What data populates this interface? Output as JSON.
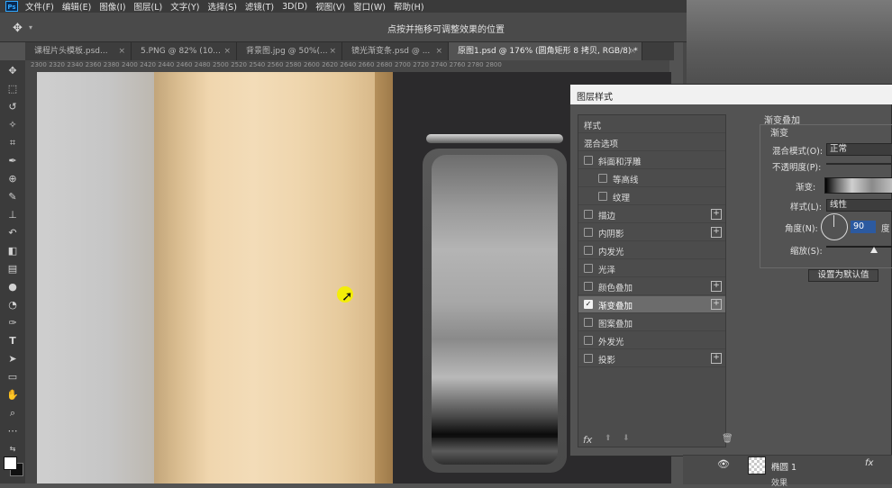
{
  "app": {
    "logo": "Ps"
  },
  "menu": [
    "文件(F)",
    "编辑(E)",
    "图像(I)",
    "图层(L)",
    "文字(Y)",
    "选择(S)",
    "滤镜(T)",
    "3D(D)",
    "视图(V)",
    "窗口(W)",
    "帮助(H)"
  ],
  "options_bar": {
    "hint": "点按并拖移可调整效果的位置"
  },
  "tabs": [
    {
      "label": "课程片头模板.psd...",
      "close": "×"
    },
    {
      "label": "5.PNG @ 82% (10...",
      "close": "×"
    },
    {
      "label": "背景图.jpg @ 50%(...",
      "close": "×"
    },
    {
      "label": "镜光渐变条.psd @ ...",
      "close": "×"
    },
    {
      "label": "原图1.psd @ 176% (圆角矩形 8 拷贝, RGB/8) *",
      "close": "×"
    }
  ],
  "ruler_ticks": [
    "2300",
    "2320",
    "2340",
    "2360",
    "2380",
    "2400",
    "2420",
    "2440",
    "2460",
    "2480",
    "2500",
    "2520",
    "2540",
    "2560",
    "2580",
    "2600",
    "2620",
    "2640",
    "2660",
    "2680",
    "2700",
    "2720",
    "2740",
    "2760",
    "2780",
    "2800"
  ],
  "dialog": {
    "title": "图层样式",
    "styles_header": "样式",
    "blend_options": "混合选项",
    "items": [
      {
        "label": "斜面和浮雕",
        "checked": false,
        "plus": false,
        "indent": false
      },
      {
        "label": "等高线",
        "checked": false,
        "plus": false,
        "indent": true
      },
      {
        "label": "纹理",
        "checked": false,
        "plus": false,
        "indent": true
      },
      {
        "label": "描边",
        "checked": false,
        "plus": true,
        "indent": false
      },
      {
        "label": "内阴影",
        "checked": false,
        "plus": true,
        "indent": false
      },
      {
        "label": "内发光",
        "checked": false,
        "plus": false,
        "indent": false
      },
      {
        "label": "光泽",
        "checked": false,
        "plus": false,
        "indent": false
      },
      {
        "label": "颜色叠加",
        "checked": false,
        "plus": true,
        "indent": false
      },
      {
        "label": "渐变叠加",
        "checked": true,
        "plus": true,
        "indent": false,
        "selected": true
      },
      {
        "label": "图案叠加",
        "checked": false,
        "plus": false,
        "indent": false
      },
      {
        "label": "外发光",
        "checked": false,
        "plus": false,
        "indent": false
      },
      {
        "label": "投影",
        "checked": false,
        "plus": true,
        "indent": false
      }
    ],
    "fx_label": "fx",
    "gradient_overlay": {
      "title": "渐变叠加",
      "subtitle": "渐变",
      "blend_mode_label": "混合模式(O):",
      "blend_mode_value": "正常",
      "opacity_label": "不透明度(P):",
      "gradient_label": "渐变:",
      "style_label": "样式(L):",
      "style_value": "线性",
      "angle_label": "角度(N):",
      "angle_value": "90",
      "angle_unit": "度",
      "scale_label": "缩放(S):",
      "default_button": "设置为默认值"
    }
  },
  "layers": {
    "name": "椭圆 1",
    "fx": "fx",
    "effects": "效果"
  }
}
